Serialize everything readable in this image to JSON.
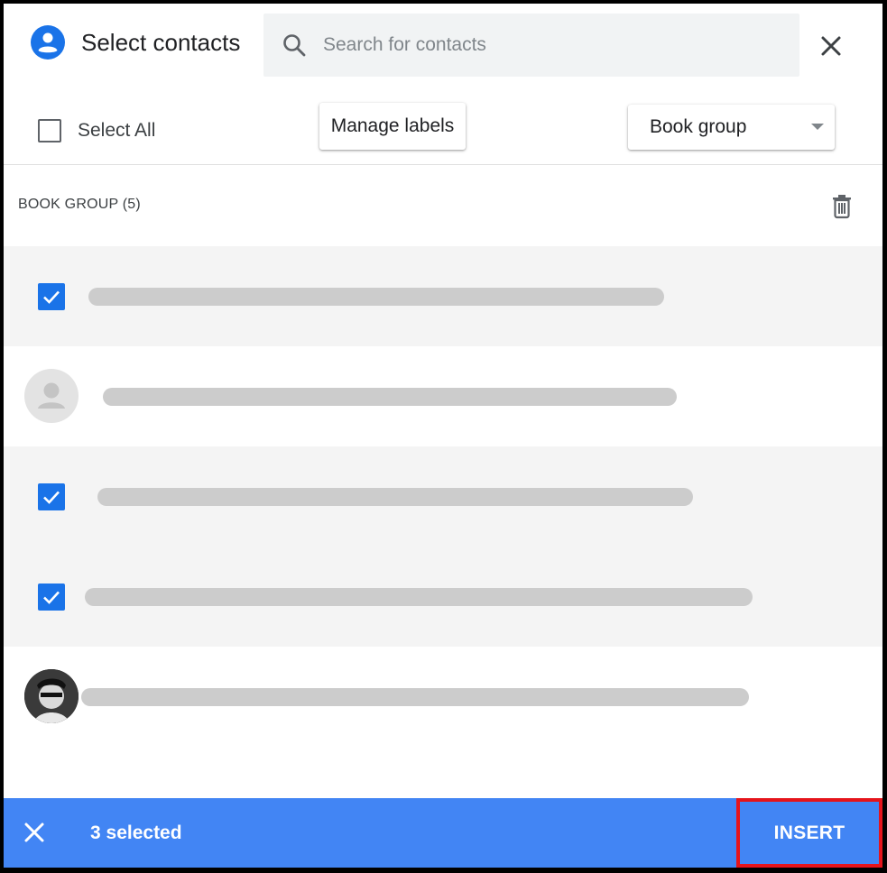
{
  "header": {
    "title": "Select contacts",
    "search_placeholder": "Search for contacts",
    "search_value": ""
  },
  "toolbar": {
    "select_all_label": "Select All",
    "manage_labels": "Manage labels",
    "label_filter": {
      "selected": "Book group"
    }
  },
  "group": {
    "header": "BOOK GROUP (5)"
  },
  "contacts": [
    {
      "selected": true,
      "avatar": "checkbox-checked",
      "redacted": true
    },
    {
      "selected": false,
      "avatar": "default-person-avatar",
      "redacted": true
    },
    {
      "selected": true,
      "avatar": "checkbox-checked",
      "redacted": true
    },
    {
      "selected": true,
      "avatar": "checkbox-checked",
      "redacted": true
    },
    {
      "selected": false,
      "avatar": "photo-avatar",
      "redacted": true
    }
  ],
  "footer": {
    "selected_count": "3 selected",
    "insert_label": "INSERT"
  },
  "colors": {
    "accent": "#4285f4",
    "checkbox": "#1a73e8",
    "highlight_border": "#e5141b",
    "selected_row": "#f4f4f4",
    "redaction": "#cccccc"
  },
  "icons": [
    "account-circle-icon",
    "search-icon",
    "close-icon",
    "delete-icon",
    "checkbox-checked-icon",
    "person-icon",
    "dropdown-arrow-icon"
  ]
}
